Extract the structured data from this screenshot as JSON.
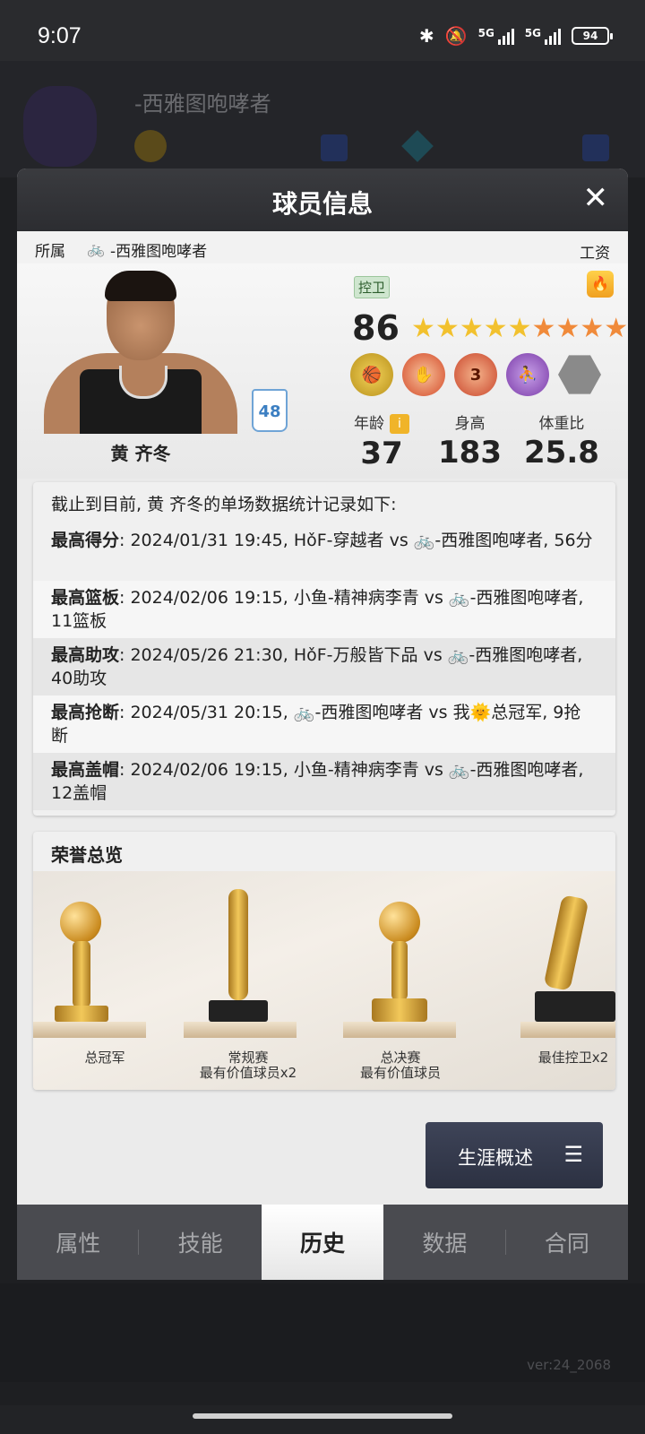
{
  "status_bar": {
    "time": "9:07",
    "network1": "5G",
    "network2": "5G",
    "battery": "94"
  },
  "background": {
    "team_name": "-西雅图咆哮者",
    "version": "ver:24_2068"
  },
  "dialog": {
    "title": "球员信息",
    "close_label": "✕"
  },
  "team_bar": {
    "label": "所属",
    "team": "-西雅图咆哮者",
    "salary_label": "工资"
  },
  "player": {
    "name": "黄 齐冬",
    "number": "48",
    "position": "控卫",
    "overall": "86",
    "stars_gold": 5,
    "stars_orange": 5,
    "badges": [
      "badge-1",
      "badge-2",
      "3",
      "badge-4",
      "badge-5"
    ],
    "attrs": [
      {
        "label": "年龄",
        "value": "37"
      },
      {
        "label": "身高",
        "value": "183"
      },
      {
        "label": "体重比",
        "value": "25.8"
      }
    ]
  },
  "records": {
    "intro": "截止到目前, 黄 齐冬的单场数据统计记录如下:",
    "items": [
      {
        "key": "最高得分",
        "text": ": 2024/01/31 19:45, HǒF-穿越者 vs 🚲-西雅图咆哮者, 56分"
      },
      {
        "key": "最高篮板",
        "text": ": 2024/02/06 19:15, 小鱼-精神病李青 vs 🚲-西雅图咆哮者, 11篮板"
      },
      {
        "key": "最高助攻",
        "text": ": 2024/05/26 21:30, HǒF-万般皆下品 vs 🚲-西雅图咆哮者, 40助攻"
      },
      {
        "key": "最高抢断",
        "text": ": 2024/05/31 20:15, 🚲-西雅图咆哮者 vs 我🌞总冠军, 9抢断"
      },
      {
        "key": "最高盖帽",
        "text": ": 2024/02/06 19:15, 小鱼-精神病李青 vs 🚲-西雅图咆哮者, 12盖帽"
      }
    ]
  },
  "honors": {
    "title": "荣誉总览",
    "items": [
      {
        "line1": "总冠军",
        "line2": ""
      },
      {
        "line1": "常规赛",
        "line2": "最有价值球员x2"
      },
      {
        "line1": "总决赛",
        "line2": "最有价值球员"
      },
      {
        "line1": "最佳控卫x2",
        "line2": ""
      }
    ]
  },
  "career_button": {
    "label": "生涯概述",
    "icon": "☰"
  },
  "tabs": [
    {
      "label": "属性",
      "active": false
    },
    {
      "label": "技能",
      "active": false
    },
    {
      "label": "历史",
      "active": true
    },
    {
      "label": "数据",
      "active": false
    },
    {
      "label": "合同",
      "active": false
    }
  ]
}
